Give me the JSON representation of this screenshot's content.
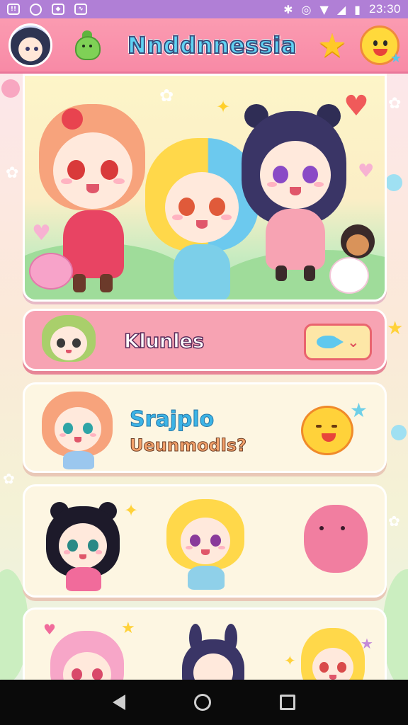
{
  "status_bar": {
    "time": "23:30",
    "left_icons": [
      "notification-icon",
      "shield-icon",
      "app-icon",
      "mail-icon"
    ],
    "right_icons": [
      "bluetooth-icon",
      "vibrate-icon",
      "wifi-icon",
      "cell-signal-icon",
      "battery-icon"
    ]
  },
  "header": {
    "title": "Nnddnnessia",
    "left_icons": [
      "profile-avatar",
      "dino-icon"
    ],
    "right_icons": [
      "star-icon",
      "smiley-icon"
    ]
  },
  "cards": [
    {
      "title": "Klunles",
      "accent": "#f7a3b3",
      "control": "dropdown"
    },
    {
      "title": "Srajplo",
      "subtitle": "Ueunmodls?",
      "accent": "#fdf6e2"
    },
    {
      "title": "",
      "accent": "#fdf6e2"
    },
    {
      "title": "",
      "accent": "#fdf6e2"
    }
  ],
  "colors": {
    "status_bar": "#b07fd6",
    "header": "#f88aa6",
    "title_fill": "#5fd3f3"
  },
  "nav_bar": [
    "back-icon",
    "home-icon",
    "recents-icon"
  ]
}
